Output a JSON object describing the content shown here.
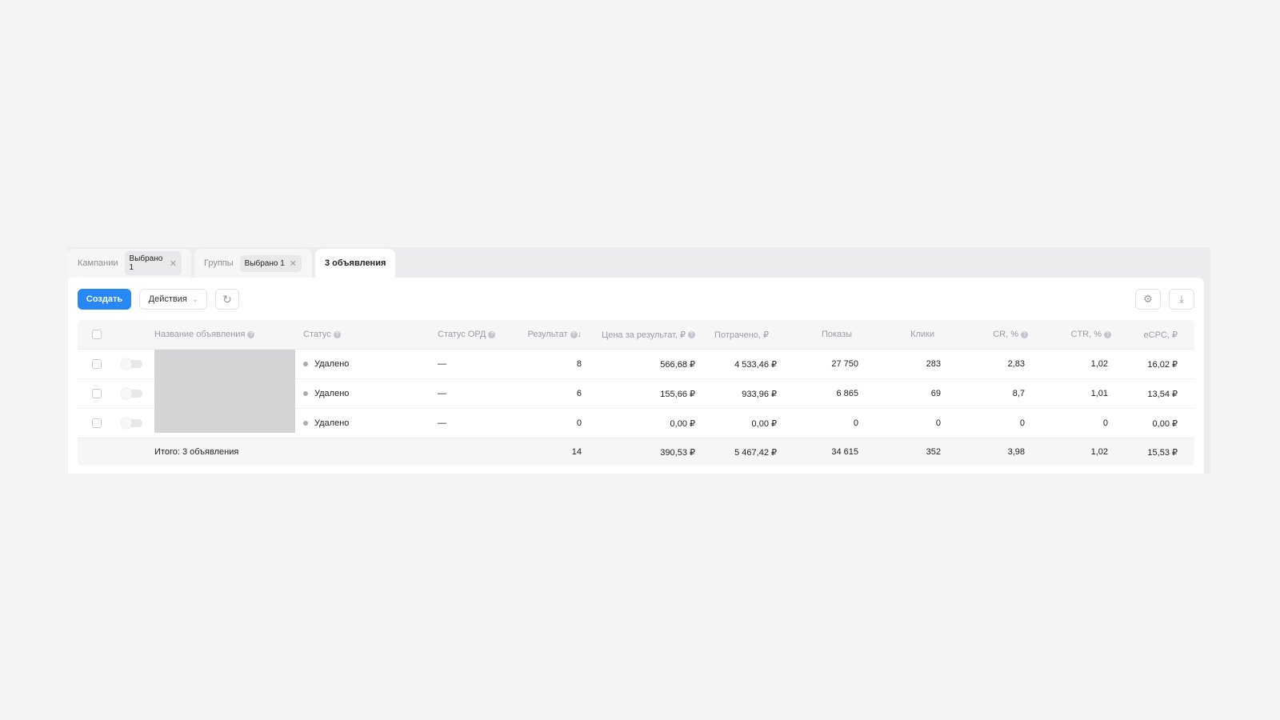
{
  "tabs": [
    {
      "label": "Кампании",
      "chip": "Выбрано 1"
    },
    {
      "label": "Группы",
      "chip": "Выбрано 1"
    },
    {
      "label": "3 объявления"
    }
  ],
  "toolbar": {
    "create": "Создать",
    "actions": "Действия"
  },
  "columns": [
    "Название объявления",
    "Статус",
    "Статус ОРД",
    "Результат",
    "Цена за результат, ₽",
    "Потрачено, ₽",
    "Показы",
    "Клики",
    "CR, %",
    "CTR, %",
    "eCPC, ₽"
  ],
  "rows": [
    {
      "status": "Удалено",
      "ord": "—",
      "result": "8",
      "price": "566,68 ₽",
      "spent": "4 533,46 ₽",
      "shows": "27 750",
      "clicks": "283",
      "cr": "2,83",
      "ctr": "1,02",
      "ecpc": "16,02 ₽"
    },
    {
      "status": "Удалено",
      "ord": "—",
      "result": "6",
      "price": "155,66 ₽",
      "spent": "933,96 ₽",
      "shows": "6 865",
      "clicks": "69",
      "cr": "8,7",
      "ctr": "1,01",
      "ecpc": "13,54 ₽"
    },
    {
      "status": "Удалено",
      "ord": "—",
      "result": "0",
      "price": "0,00 ₽",
      "spent": "0,00 ₽",
      "shows": "0",
      "clicks": "0",
      "cr": "0",
      "ctr": "0",
      "ecpc": "0,00 ₽"
    }
  ],
  "total": {
    "label": "Итого: 3 объявления",
    "result": "14",
    "price": "390,53 ₽",
    "spent": "5 467,42 ₽",
    "shows": "34 615",
    "clicks": "352",
    "cr": "3,98",
    "ctr": "1,02",
    "ecpc": "15,53 ₽"
  },
  "colors": {
    "accent": "#2787f5"
  }
}
